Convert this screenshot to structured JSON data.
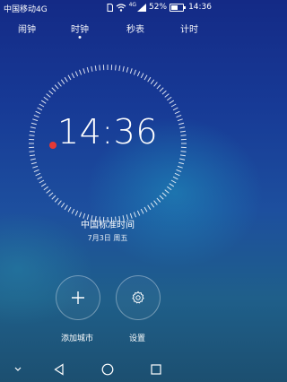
{
  "status_bar": {
    "carrier": "中国移动4G",
    "network": "4G",
    "battery_text": "52%",
    "battery_level": 0.52,
    "clock": "14:36",
    "icons": [
      "sim-icon",
      "wifi-icon",
      "signal-icon",
      "battery-icon"
    ]
  },
  "tabs": [
    {
      "label": "闹钟",
      "active": false
    },
    {
      "label": "时钟",
      "active": true
    },
    {
      "label": "秒表",
      "active": false
    },
    {
      "label": "计时",
      "active": false
    }
  ],
  "clock": {
    "time": "14:36",
    "timezone": "中国标准时间",
    "date": "7月3日 周五",
    "second_marker_color": "#e53935"
  },
  "actions": {
    "add_city": {
      "label": "添加城市",
      "icon": "plus-icon"
    },
    "settings": {
      "label": "设置",
      "icon": "gear-icon"
    }
  },
  "navbar": {
    "icons": [
      "collapse-icon",
      "back-icon",
      "home-icon",
      "recents-icon"
    ]
  }
}
